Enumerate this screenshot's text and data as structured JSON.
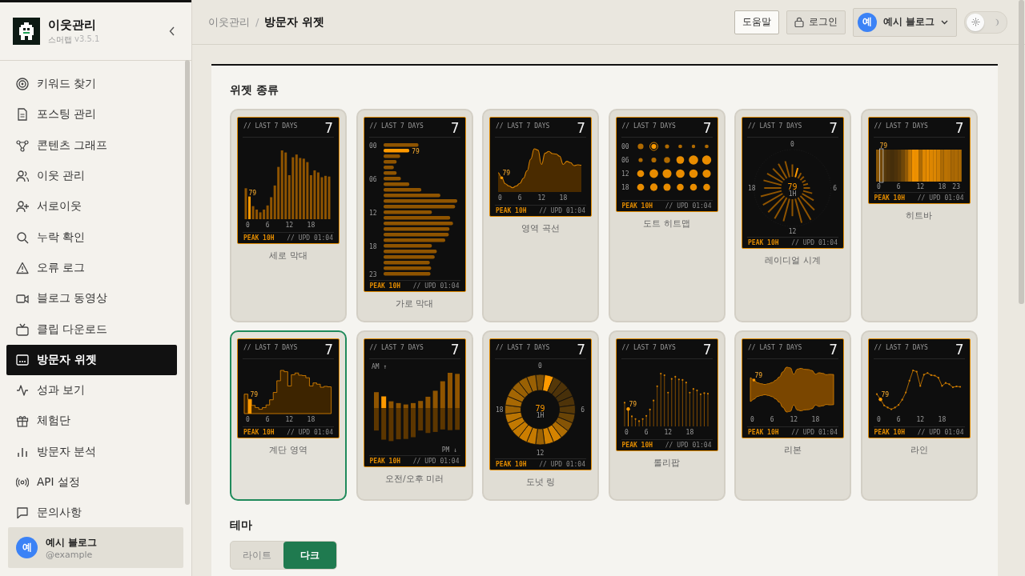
{
  "sidebar": {
    "brand": {
      "title": "이웃관리",
      "subtitle": "스머랩",
      "version": "v3.5.1"
    },
    "items": [
      {
        "label": "키워드 찾기",
        "selected": false
      },
      {
        "label": "포스팅 관리",
        "selected": false
      },
      {
        "label": "콘텐츠 그래프",
        "selected": false
      },
      {
        "label": "이웃 관리",
        "selected": false
      },
      {
        "label": "서로이웃",
        "selected": false
      },
      {
        "label": "누락 확인",
        "selected": false
      },
      {
        "label": "오류 로그",
        "selected": false
      },
      {
        "label": "블로그 동영상",
        "selected": false
      },
      {
        "label": "클립 다운로드",
        "selected": false
      },
      {
        "label": "방문자 위젯",
        "selected": true
      },
      {
        "label": "성과 보기",
        "selected": false
      },
      {
        "label": "체험단",
        "selected": false
      },
      {
        "label": "방문자 분석",
        "selected": false
      },
      {
        "label": "API 설정",
        "selected": false
      },
      {
        "label": "문의사항",
        "selected": false
      }
    ],
    "user": {
      "avatar": "예",
      "name": "예시 블로그",
      "handle": "@example"
    }
  },
  "header": {
    "breadcrumb": [
      "이웃관리",
      "방문자 위젯"
    ],
    "separator": "/",
    "help_button": "도움말",
    "login_button": "로그인",
    "account": {
      "avatar": "예",
      "name": "예시 블로그"
    },
    "theme_toggle": {
      "dark": false
    }
  },
  "widget_section": {
    "title": "위젯 종류",
    "widgets": [
      {
        "name": "세로 막대",
        "kind": "vbar",
        "selected": false,
        "header": "// LAST 7 DAYS",
        "count": "7",
        "ticks": [
          "0",
          "6",
          "12",
          "18"
        ],
        "marker": "79",
        "peak": "PEAK 10H",
        "updated": "// UPD 01:04"
      },
      {
        "name": "가로 막대",
        "kind": "hbar",
        "selected": false,
        "header": "// LAST 7 DAYS",
        "count": "7",
        "ticks": [
          "00",
          "06",
          "12",
          "18",
          "23"
        ],
        "marker": "79",
        "peak": "PEAK 10H",
        "updated": "// UPD 01:04"
      },
      {
        "name": "영역 곡선",
        "kind": "area",
        "selected": false,
        "header": "// LAST 7 DAYS",
        "count": "7",
        "ticks": [
          "0",
          "6",
          "12",
          "18"
        ],
        "marker": "79",
        "peak": "PEAK 10H",
        "updated": "// UPD 01:04"
      },
      {
        "name": "도트 히트맵",
        "kind": "dots",
        "selected": false,
        "header": "// LAST 7 DAYS",
        "count": "7",
        "ticks": [
          "00",
          "06",
          "12",
          "18"
        ],
        "peak": "PEAK 10H",
        "updated": "// UPD 01:04"
      },
      {
        "name": "레이디얼 시계",
        "kind": "radial",
        "selected": false,
        "header": "// LAST 7 DAYS",
        "count": "7",
        "ticks": [
          "0",
          "6",
          "12",
          "18"
        ],
        "marker": "79",
        "center_sub": "1H",
        "peak": "PEAK 10H",
        "updated": "// UPD 01:04"
      },
      {
        "name": "히트바",
        "kind": "heat",
        "selected": false,
        "header": "// LAST 7 DAYS",
        "count": "7",
        "ticks": [
          "0",
          "6",
          "12",
          "18",
          "23"
        ],
        "marker": "79",
        "peak": "PEAK 10H",
        "updated": "// UPD 01:04"
      },
      {
        "name": "계단 영역",
        "kind": "step",
        "selected": true,
        "header": "// LAST 7 DAYS",
        "count": "7",
        "ticks": [
          "0",
          "6",
          "12",
          "18"
        ],
        "marker": "79",
        "peak": "PEAK 10H",
        "updated": "// UPD 01:04"
      },
      {
        "name": "오전/오후 미러",
        "kind": "mirror",
        "selected": false,
        "header": "// LAST 7 DAYS",
        "count": "7",
        "top_label": "AM ↑",
        "bottom_label": "PM ↓",
        "peak": "PEAK 10H",
        "updated": "// UPD 01:04"
      },
      {
        "name": "도넛 링",
        "kind": "donut",
        "selected": false,
        "header": "// LAST 7 DAYS",
        "count": "7",
        "ticks": [
          "0",
          "6",
          "12",
          "18"
        ],
        "marker": "79",
        "center_sub": "1H",
        "peak": "PEAK 10H",
        "updated": "// UPD 01:04"
      },
      {
        "name": "롤리팝",
        "kind": "lollipop",
        "selected": false,
        "header": "// LAST 7 DAYS",
        "count": "7",
        "ticks": [
          "0",
          "6",
          "12",
          "18"
        ],
        "marker": "79",
        "peak": "PEAK 10H",
        "updated": "// UPD 01:04"
      },
      {
        "name": "리본",
        "kind": "ribbon",
        "selected": false,
        "header": "// LAST 7 DAYS",
        "count": "7",
        "ticks": [
          "0",
          "6",
          "12",
          "18"
        ],
        "marker": "79",
        "peak": "PEAK 10H",
        "updated": "// UPD 01:04"
      },
      {
        "name": "라인",
        "kind": "line",
        "selected": false,
        "header": "// LAST 7 DAYS",
        "count": "7",
        "ticks": [
          "0",
          "6",
          "12",
          "18"
        ],
        "marker": "79",
        "peak": "PEAK 10H",
        "updated": "// UPD 01:04"
      }
    ]
  },
  "theme_section": {
    "title": "테마",
    "options": [
      {
        "label": "라이트",
        "selected": false
      },
      {
        "label": "다크",
        "selected": true
      }
    ]
  }
}
